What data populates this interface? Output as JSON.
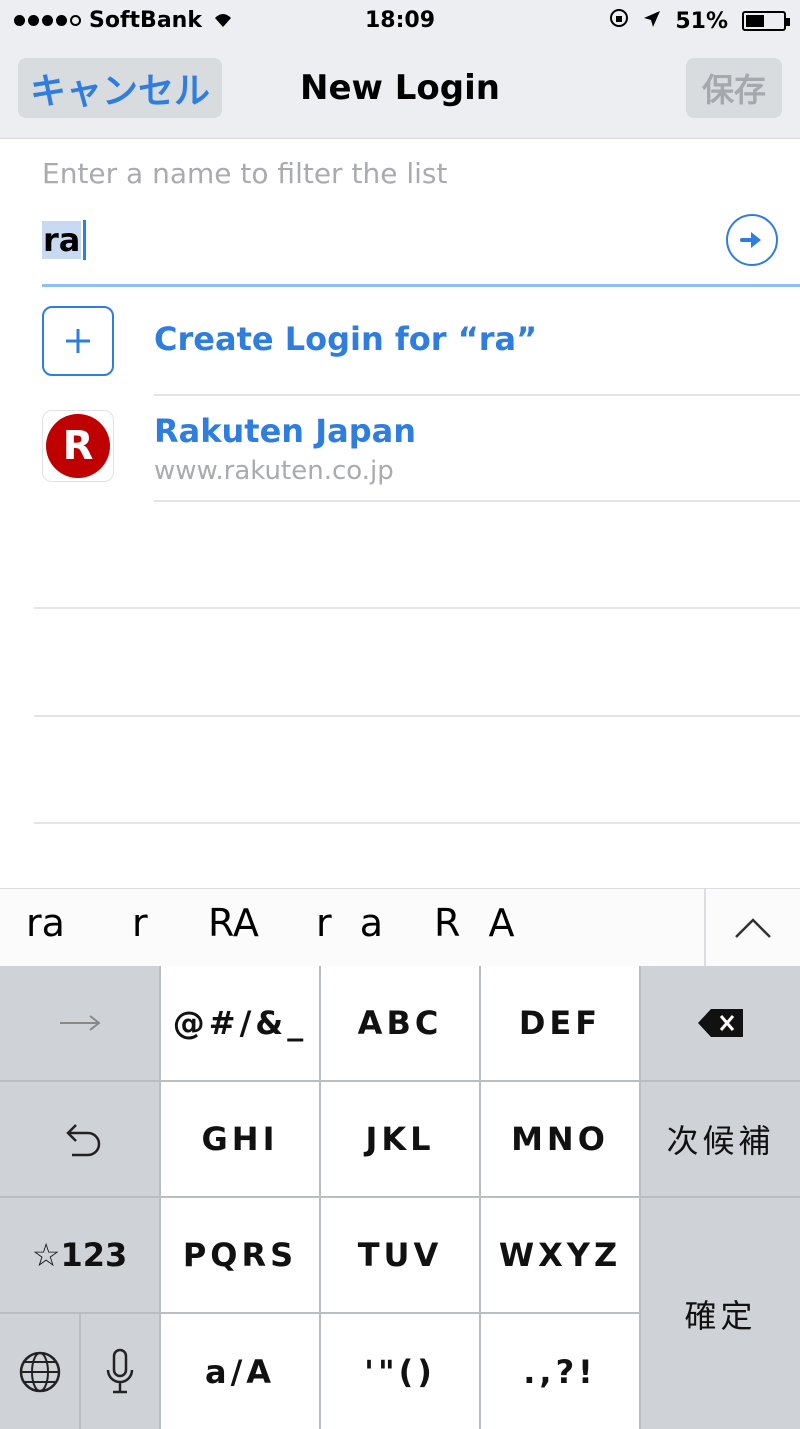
{
  "status_bar": {
    "carrier": "SoftBank",
    "time": "18:09",
    "battery": "51%",
    "battery_level": 0.51,
    "signal_bars_filled": 4,
    "signal_bars_total": 5
  },
  "nav": {
    "cancel_label": "キャンセル",
    "title": "New Login",
    "save_label": "保存"
  },
  "filter": {
    "placeholder": "Enter a name to filter the list",
    "value": "ra"
  },
  "list": {
    "create_label": "Create Login for “ra”",
    "items": [
      {
        "title": "Rakuten Japan",
        "subtitle": "www.rakuten.co.jp",
        "logo_letter": "R"
      }
    ]
  },
  "suggestions": [
    "ra",
    "r",
    "RA",
    "r a",
    "R A"
  ],
  "keyboard": {
    "rows": [
      [
        "→",
        "@#/&_",
        "ABC",
        "DEF",
        "⌫"
      ],
      [
        "↺",
        "GHI",
        "JKL",
        "MNO",
        "次候補"
      ],
      [
        "☆123",
        "PQRS",
        "TUV",
        "WXYZ",
        "確定"
      ],
      [
        "globe",
        "mic",
        "a/A",
        "'\"()",
        ".,?!"
      ]
    ],
    "labels": {
      "arrow": "→",
      "sym": "@#/&_",
      "abc": "ABC",
      "def": "DEF",
      "ghi": "GHI",
      "jkl": "JKL",
      "mno": "MNO",
      "next": "次候補",
      "num": "☆123",
      "pqrs": "PQRS",
      "tuv": "TUV",
      "wxyz": "WXYZ",
      "confirm": "確定",
      "case": "a/A",
      "quotes": "'\"()",
      "punct": ".,?!"
    }
  },
  "colors": {
    "accent": "#2f7ddf",
    "rakuten": "#bf0000",
    "muted": "#a9abb0"
  }
}
